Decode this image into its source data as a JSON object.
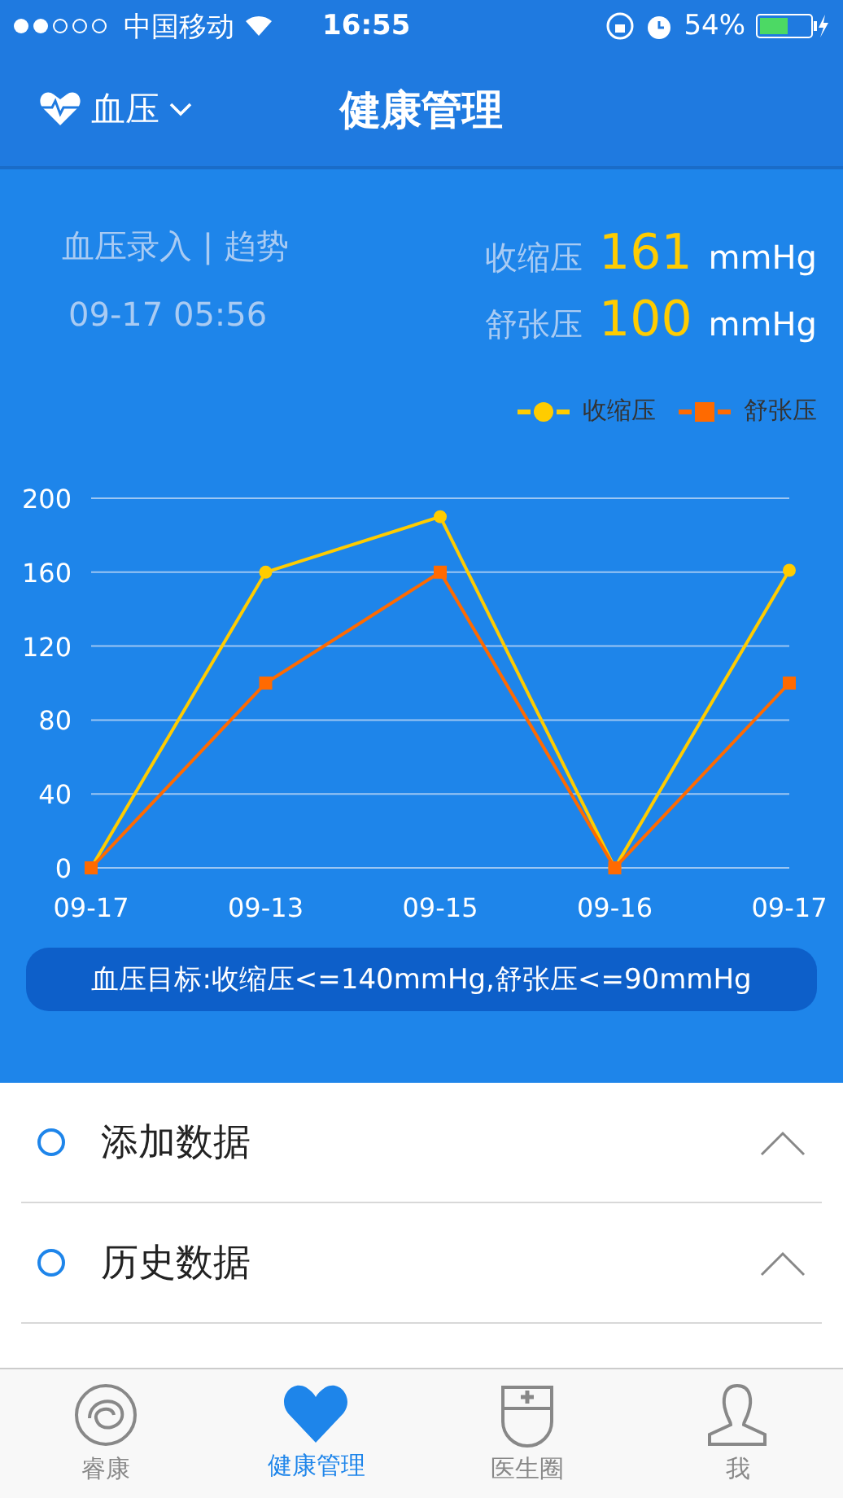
{
  "status_bar": {
    "carrier": "中国移动",
    "time": "16:55",
    "battery": "54%"
  },
  "nav": {
    "selector": "血压",
    "title": "健康管理"
  },
  "summary": {
    "heading": "血压录入 | 趋势",
    "timestamp": "09-17 05:56",
    "readings": [
      {
        "label": "收缩压",
        "value": "161",
        "unit": "mmHg"
      },
      {
        "label": "舒张压",
        "value": "100",
        "unit": "mmHg"
      }
    ]
  },
  "chart_data": {
    "type": "line",
    "grid": true,
    "categories": [
      "09-17",
      "09-13",
      "09-15",
      "09-16",
      "09-17"
    ],
    "yticks": [
      0,
      40,
      80,
      120,
      160,
      200
    ],
    "ylim": [
      0,
      200
    ],
    "series": [
      {
        "name": "收缩压",
        "color": "#ffcc00",
        "marker": "circle",
        "values": [
          0,
          160,
          190,
          0,
          161
        ]
      },
      {
        "name": "舒张压",
        "color": "#ff6a00",
        "marker": "square",
        "values": [
          0,
          100,
          160,
          0,
          100
        ]
      }
    ]
  },
  "goal": "血压目标:收缩压<=140mmHg,舒张压<=90mmHg",
  "sections": [
    {
      "label": "添加数据",
      "expanded": false
    },
    {
      "label": "历史数据",
      "expanded": false
    }
  ],
  "tab_bar": [
    {
      "label": "睿康",
      "selected": false
    },
    {
      "label": "健康管理",
      "selected": true
    },
    {
      "label": "医生圈",
      "selected": false
    },
    {
      "label": "我",
      "selected": false
    }
  ]
}
